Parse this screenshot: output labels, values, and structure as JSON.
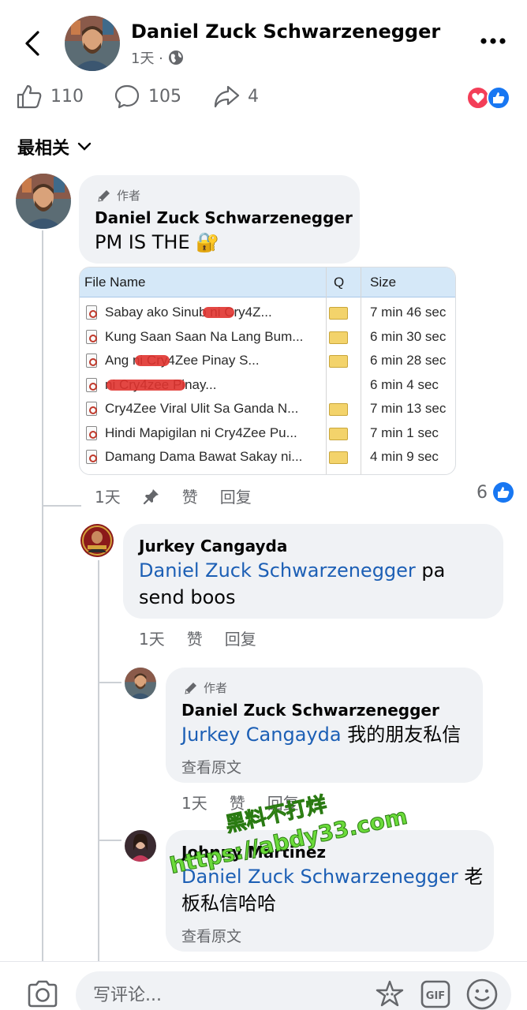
{
  "header": {
    "author_name": "Daniel Zuck Schwarzenegger",
    "post_time": "1天 ·",
    "privacy_icon": "globe-icon",
    "back_icon": "chevron-left-icon",
    "more_icon": "more-horizontal-icon"
  },
  "stats": {
    "likes": "110",
    "comments": "105",
    "shares": "4",
    "reaction_icons": [
      "heart-icon",
      "like-icon"
    ]
  },
  "sort": {
    "label": "最相关"
  },
  "comments": [
    {
      "badge": "作者",
      "name": "Daniel Zuck Schwarzenegger",
      "text": "PM IS THE",
      "emoji": "🔐",
      "time": "1天",
      "like": "赞",
      "reply": "回复",
      "like_count": "6",
      "attachment": {
        "headers": {
          "name": "File Name",
          "q": "Q",
          "size": "Size"
        },
        "rows": [
          {
            "name": "Sabay ako Sinub      ni Cry4Z...",
            "size": "7 min 46 sec",
            "folder": true
          },
          {
            "name": "Kung Saan Saan Na Lang Bum...",
            "size": "6 min 30 sec",
            "folder": true
          },
          {
            "name": "Ang         ni Cry4Zee Pinay S...",
            "size": "6 min 28 sec",
            "folder": true
          },
          {
            "name": "                  ni Cry4zee Pinay...",
            "size": "6 min 4 sec",
            "folder": false
          },
          {
            "name": "Cry4Zee Viral Ulit Sa Ganda N...",
            "size": "7 min 13 sec",
            "folder": true
          },
          {
            "name": "Hindi Mapigilan ni Cry4Zee Pu...",
            "size": "7 min 1 sec",
            "folder": true
          },
          {
            "name": "Damang Dama Bawat Sakay ni...",
            "size": "4 min 9 sec",
            "folder": true
          }
        ]
      }
    },
    {
      "name": "Jurkey Cangayda",
      "mention": "Daniel Zuck Schwarzenegger",
      "text": " pa send boos",
      "time": "1天",
      "like": "赞",
      "reply": "回复"
    },
    {
      "badge": "作者",
      "name": "Daniel Zuck Schwarzenegger",
      "mention": "Jurkey Cangayda",
      "text": " 我的朋友私信",
      "see_original": "查看原文",
      "time": "1天",
      "like": "赞",
      "reply": "回复"
    },
    {
      "name": "Johnny Martinez",
      "mention": "Daniel Zuck Schwarzenegger",
      "text": " 老板私信哈哈",
      "see_original": "查看原文"
    }
  ],
  "watermark": {
    "line1": "黑料不打烊",
    "line2": "https://abdy33.com"
  },
  "composer": {
    "placeholder": "写评论..."
  },
  "colors": {
    "link": "#1c5fb5",
    "like_blue": "#1877f2",
    "love_red": "#f33e58",
    "bubble": "#f0f2f5"
  }
}
